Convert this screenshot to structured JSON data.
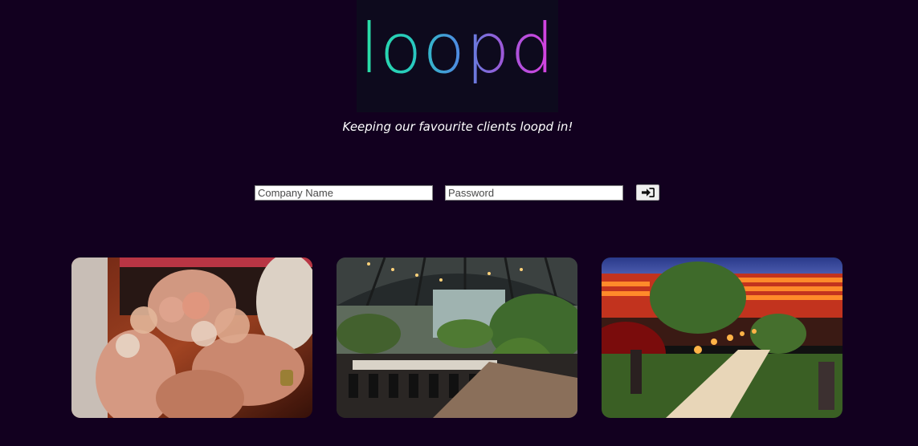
{
  "brand": {
    "logo": "loopd"
  },
  "tagline": "Keeping our favourite clients loopd in!",
  "login": {
    "company_placeholder": "Company Name",
    "password_placeholder": "Password",
    "submit_icon": "sign-in-icon"
  },
  "gallery": [
    {
      "icon": "photo-cocktail-toast"
    },
    {
      "icon": "photo-glasshouse-venue"
    },
    {
      "icon": "photo-stadium-dinner"
    }
  ]
}
